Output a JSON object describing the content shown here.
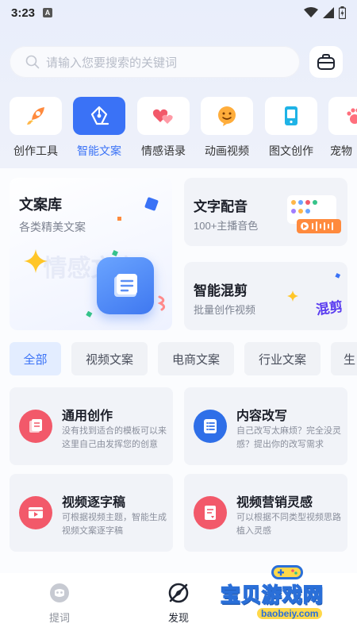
{
  "status": {
    "time": "3:23",
    "sim_label": "A"
  },
  "search": {
    "placeholder": "请输入您要搜索的关键词"
  },
  "categories": [
    {
      "label": "创作工具",
      "icon": "rocket-icon",
      "active": false
    },
    {
      "label": "智能文案",
      "icon": "pen-nib-icon",
      "active": true
    },
    {
      "label": "情感语录",
      "icon": "hearts-icon",
      "active": false
    },
    {
      "label": "动画视频",
      "icon": "smiley-icon",
      "active": false
    },
    {
      "label": "图文创作",
      "icon": "phone-icon",
      "active": false
    },
    {
      "label": "宠物",
      "icon": "paw-icon",
      "active": false
    }
  ],
  "features": {
    "library": {
      "title": "文案库",
      "subtitle": "各类精美文案",
      "bg_text": "情感文案"
    },
    "voice": {
      "title": "文字配音",
      "subtitle": "100+主播音色"
    },
    "mix": {
      "title": "智能混剪",
      "subtitle": "批量创作视频",
      "art_text": "混剪"
    }
  },
  "chips": [
    {
      "label": "全部",
      "active": true
    },
    {
      "label": "视频文案",
      "active": false
    },
    {
      "label": "电商文案",
      "active": false
    },
    {
      "label": "行业文案",
      "active": false
    },
    {
      "label": "生",
      "active": false
    }
  ],
  "functions": [
    {
      "title": "通用创作",
      "desc": "没有找到适合的模板可以来这里自己由发挥您的创意",
      "color": "#f2596a",
      "icon": "document-icon"
    },
    {
      "title": "内容改写",
      "desc": "自己改写太麻烦？完全没灵感？提出你的改写需求",
      "color": "#2f6fe8",
      "icon": "list-icon"
    },
    {
      "title": "视频逐字稿",
      "desc": "可根据视频主题，智能生成视频文案逐字稿",
      "color": "#f2596a",
      "icon": "video-play-icon"
    },
    {
      "title": "视频营销灵感",
      "desc": "可以根据不同类型视频思路植入灵感",
      "color": "#f2596a",
      "icon": "note-icon"
    }
  ],
  "nav": [
    {
      "label": "提词",
      "icon": "prompter-icon",
      "active": false
    },
    {
      "label": "发现",
      "icon": "compass-icon",
      "active": true
    }
  ],
  "watermark": {
    "title": "宝贝游戏网",
    "url": "baobeiy.com"
  },
  "colors": {
    "accent": "#3a72f6",
    "red": "#f2596a",
    "blue": "#2f6fe8"
  }
}
